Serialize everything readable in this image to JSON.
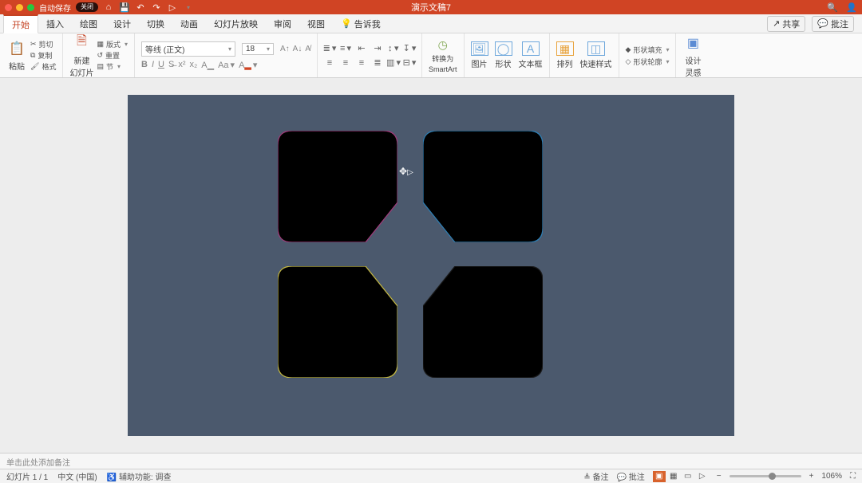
{
  "titlebar": {
    "autosave_label": "自动保存",
    "autosave_state": "关闭",
    "doc_title": "演示文稿7"
  },
  "tabs": {
    "home": "开始",
    "insert": "插入",
    "draw": "绘图",
    "design": "设计",
    "transition": "切换",
    "animation": "动画",
    "slideshow": "幻灯片放映",
    "review": "审阅",
    "view": "视图",
    "tell_me": "告诉我"
  },
  "tabbar_right": {
    "share": "共享",
    "comments": "批注"
  },
  "ribbon": {
    "paste": "粘贴",
    "clip_cut": "剪切",
    "clip_copy": "复制",
    "clip_fmt": "格式",
    "new_slide": "新建\n幻灯片",
    "layout": "版式",
    "reset": "重置",
    "section": "节",
    "font_name": "等线 (正文)",
    "font_size": "18",
    "smartart_convert": "转换为",
    "smartart_label": "SmartArt",
    "picture": "图片",
    "shapes": "形状",
    "textbox": "文本框",
    "arrange": "排列",
    "quick_styles": "快速样式",
    "shape_fill": "形状填充",
    "shape_outline": "形状轮廓",
    "design_ideas": "设计\n灵感"
  },
  "notes_placeholder": "单击此处添加备注",
  "status": {
    "slide_n": "幻灯片 1 / 1",
    "lang": "中文 (中国)",
    "a11y": "辅助功能: 调查",
    "notes_btn": "备注",
    "comments_btn": "批注",
    "zoom": "106%"
  }
}
